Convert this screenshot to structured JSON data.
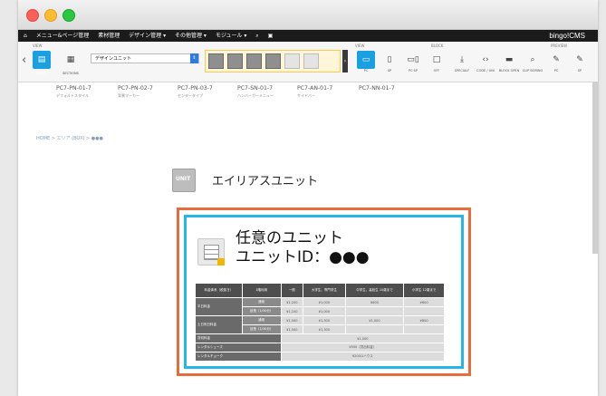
{
  "window": {
    "traffic_lights": [
      "close",
      "minimize",
      "zoom"
    ]
  },
  "menubar": {
    "items": [
      "メニュー&ページ管理",
      "素材管理",
      "デザイン管理 ▾",
      "その他管理 ▾",
      "モジュール ▾"
    ],
    "brand": "bingo!CMS"
  },
  "toolbar": {
    "section_left": "VIEW",
    "btn_unit": "UNITS",
    "btn_section": "SECTIONS",
    "unit_select": "デザインユニット",
    "section_device": "VIEW",
    "section_blocks": "BLOCK",
    "section_preview": "PREVIEW",
    "devices": [
      {
        "icon": "PC",
        "label": "PC"
      },
      {
        "icon": "SP",
        "label": "SP"
      },
      {
        "icon": "PC·SP",
        "label": "PC·SP"
      },
      {
        "icon": "□",
        "label": "OFF"
      },
      {
        "icon": "⤓",
        "label": "SPECIALF"
      },
      {
        "icon": "<>",
        "label": "CODE / UNI"
      },
      {
        "icon": "▭",
        "label": "BLOCK OPEN"
      },
      {
        "icon": "⌕",
        "label": "CLIP BORING"
      },
      {
        "icon": "✎",
        "label": "PC"
      },
      {
        "icon": "✎",
        "label": "SP"
      }
    ]
  },
  "tabs": [
    {
      "code": "PC7-PN-01-7",
      "sub": "デフォルトスタイル"
    },
    {
      "code": "PC7-PN-02-7",
      "sub": "背景マーカー"
    },
    {
      "code": "PC7-PN-03-7",
      "sub": "センタータイプ"
    },
    {
      "code": "PC7-SN-01-7",
      "sub": "ハンバーガーメニュー"
    },
    {
      "code": "PC7-AN-01-7",
      "sub": "サイドバー"
    },
    {
      "code": "PC7-NN-01-7",
      "sub": ""
    }
  ],
  "breadcrumb": "HOME > エリア (BOX) > ●●●",
  "alias": {
    "icon_text": "UNIT",
    "title": "エイリアスユニット"
  },
  "unit": {
    "title_line1": "任意のユニット",
    "title_line2": "ユニットID：●●●"
  },
  "spec_table": {
    "headers": [
      "料金体系（税抜き）",
      "1階利用",
      "一般",
      "大学生、専門学生",
      "中学生、高校生 15歳まで",
      "小学生 12歳まで"
    ],
    "rows": [
      {
        "group": "平日料金",
        "sub": "通常",
        "cells": [
          "¥1,200",
          "¥1,000",
          "¥800",
          "¥600"
        ]
      },
      {
        "group": "",
        "sub": "延長（1/30分）",
        "cells": [
          "¥1,100",
          "¥1,000",
          "",
          ""
        ]
      },
      {
        "group": "土日祝日料金",
        "sub": "通常",
        "cells": [
          "¥1,500",
          "¥1,300",
          "¥1,000",
          "¥800"
        ]
      },
      {
        "group": "",
        "sub": "延長（1/30分）",
        "cells": [
          "¥1,500",
          "¥1,300",
          "",
          ""
        ]
      },
      {
        "group": "貸切料金",
        "sub": "",
        "merged": "¥1,000"
      },
      {
        "group": "レンタルシューズ",
        "sub": "",
        "merged": "¥500（貸出料金）"
      },
      {
        "group": "レンタルチョーク",
        "sub": "",
        "merged": "¥200/1ハウス"
      }
    ]
  }
}
